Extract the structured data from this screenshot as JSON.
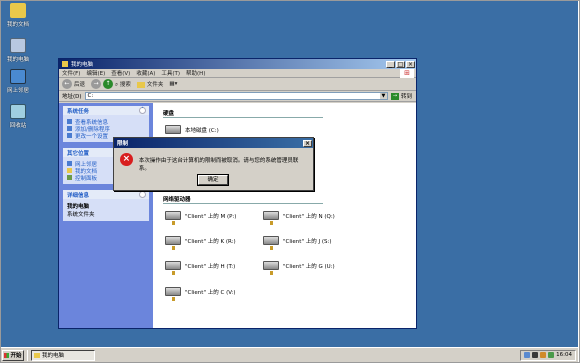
{
  "desktop": {
    "icons": [
      {
        "label": "我的文档",
        "color": "#e9c84a"
      },
      {
        "label": "我的电脑",
        "color": "#b8c8e0"
      },
      {
        "label": "网上邻居",
        "color": "#4a8ad0"
      },
      {
        "label": "回收站",
        "color": "#9fcfe0"
      }
    ]
  },
  "window": {
    "title": "我的电脑",
    "menu": [
      "文件(F)",
      "编辑(E)",
      "查看(V)",
      "收藏(A)",
      "工具(T)",
      "帮助(H)"
    ],
    "toolbar": {
      "back": "后退",
      "search": "搜索",
      "folders": "文件夹"
    },
    "address": {
      "label": "地址(D)",
      "value": "C:",
      "go": "转到"
    }
  },
  "sidebar": {
    "system_tasks": {
      "title": "系统任务",
      "items": [
        "查看系统信息",
        "添加/删除程序",
        "更改一个设置"
      ]
    },
    "other_places": {
      "title": "其它位置",
      "items": [
        "网上邻居",
        "我的文档",
        "控制面板"
      ]
    },
    "details": {
      "title": "详细信息",
      "name": "我的电脑",
      "type": "系统文件夹"
    }
  },
  "main": {
    "hard_drives_title": "硬盘",
    "local_disk": "本地磁盘 (C:)",
    "network_drives_title": "网络驱动器",
    "network_drives": [
      "\"Client\" 上的 M (P:)",
      "\"Client\" 上的 N (Q:)",
      "\"Client\" 上的 K (R:)",
      "\"Client\" 上的 J (S:)",
      "\"Client\" 上的 H (T:)",
      "\"Client\" 上的 G (U:)",
      "\"Client\" 上的 C (V:)"
    ]
  },
  "dialog": {
    "title": "限制",
    "message": "本次操作由于这台计算机的限制而被取消。请与您的系统管理员联系。",
    "ok": "确定"
  },
  "taskbar": {
    "start": "开始",
    "task": "我的电脑",
    "clock": "16:04"
  },
  "colors": {
    "desktop": "#3a6ea5",
    "titlebar": "#0a246a",
    "error": "#d81e1e"
  }
}
